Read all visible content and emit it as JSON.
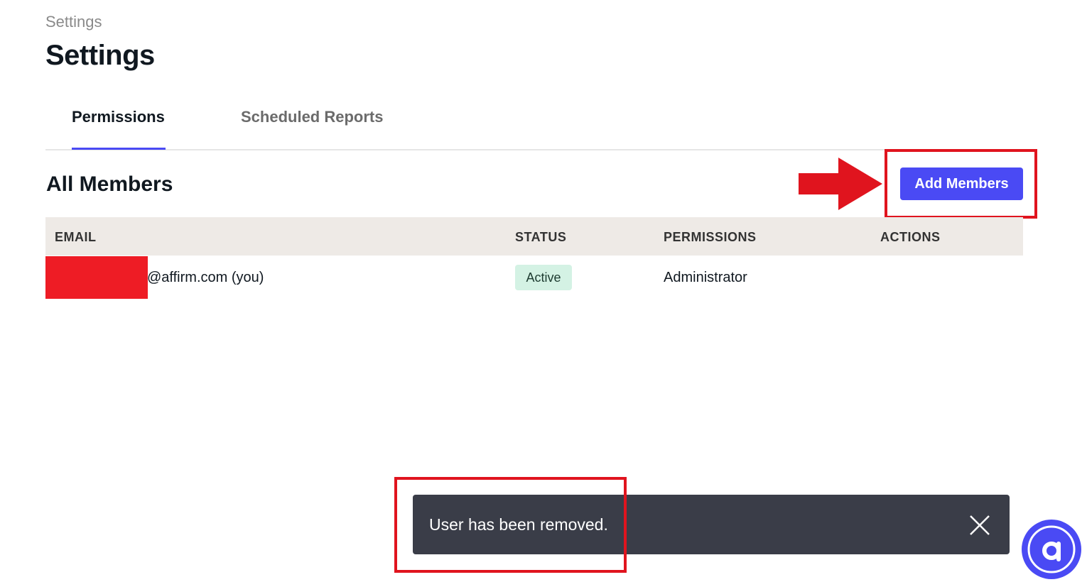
{
  "breadcrumb": "Settings",
  "page_title": "Settings",
  "tabs": [
    {
      "label": "Permissions",
      "active": true
    },
    {
      "label": "Scheduled Reports",
      "active": false
    }
  ],
  "members": {
    "title": "All Members",
    "add_button": "Add Members",
    "columns": [
      "EMAIL",
      "STATUS",
      "PERMISSIONS",
      "ACTIONS"
    ],
    "rows": [
      {
        "email": "@affirm.com (you)",
        "status": "Active",
        "permissions": "Administrator"
      }
    ]
  },
  "toast": {
    "message": "User has been removed."
  },
  "icons": {
    "close": "close-icon",
    "chat": "affirm-chat-icon"
  },
  "colors": {
    "accent": "#4a4af4",
    "annotation": "#e0141e",
    "status_active_bg": "#d4f2e4",
    "toast_bg": "#3a3d48",
    "table_header_bg": "#eeeae6"
  }
}
